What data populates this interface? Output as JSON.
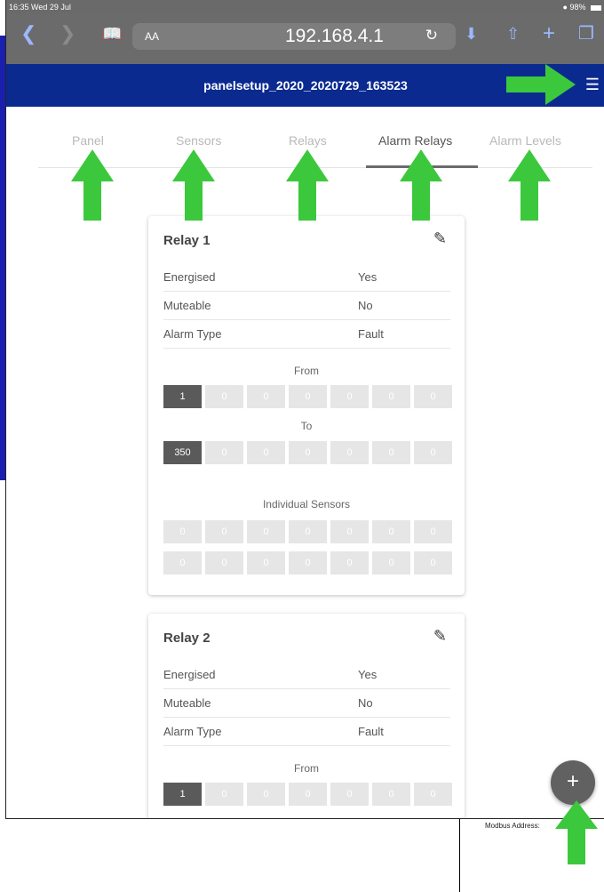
{
  "status_bar": {
    "time": "16:35  Wed 29 Jul",
    "battery": "98%"
  },
  "browser": {
    "url": "192.168.4.1",
    "text_size": "AA"
  },
  "app_bar": {
    "title": "panelsetup_2020_2020729_163523",
    "menu_icon": "hamburger-icon"
  },
  "tabs": [
    {
      "label": "Panel",
      "active": false
    },
    {
      "label": "Sensors",
      "active": false
    },
    {
      "label": "Relays",
      "active": false
    },
    {
      "label": "Alarm Relays",
      "active": true
    },
    {
      "label": "Alarm Levels",
      "active": false
    }
  ],
  "relays": [
    {
      "title": "Relay 1",
      "rows": [
        {
          "label": "Energised",
          "value": "Yes"
        },
        {
          "label": "Muteable",
          "value": "No"
        },
        {
          "label": "Alarm Type",
          "value": "Fault"
        }
      ],
      "from_label": "From",
      "from": [
        "1",
        "0",
        "0",
        "0",
        "0",
        "0",
        "0"
      ],
      "to_label": "To",
      "to": [
        "350",
        "0",
        "0",
        "0",
        "0",
        "0",
        "0"
      ],
      "individual_label": "Individual Sensors",
      "individual_a": [
        "0",
        "0",
        "0",
        "0",
        "0",
        "0",
        "0"
      ],
      "individual_b": [
        "0",
        "0",
        "0",
        "0",
        "0",
        "0",
        "0"
      ]
    },
    {
      "title": "Relay 2",
      "rows": [
        {
          "label": "Energised",
          "value": "Yes"
        },
        {
          "label": "Muteable",
          "value": "No"
        },
        {
          "label": "Alarm Type",
          "value": "Fault"
        }
      ],
      "from_label": "From",
      "from": [
        "1",
        "0",
        "0",
        "0",
        "0",
        "0",
        "0"
      ]
    }
  ],
  "fab_label": "+",
  "background_doc": {
    "modbus_label": "Modbus Address:"
  },
  "colors": {
    "app_bar": "#0b2a90",
    "arrow": "#3cc83c",
    "browser_bar": "#6b6b6b",
    "active_box": "#5a5a5a",
    "inactive_box": "#e6e6e6"
  }
}
